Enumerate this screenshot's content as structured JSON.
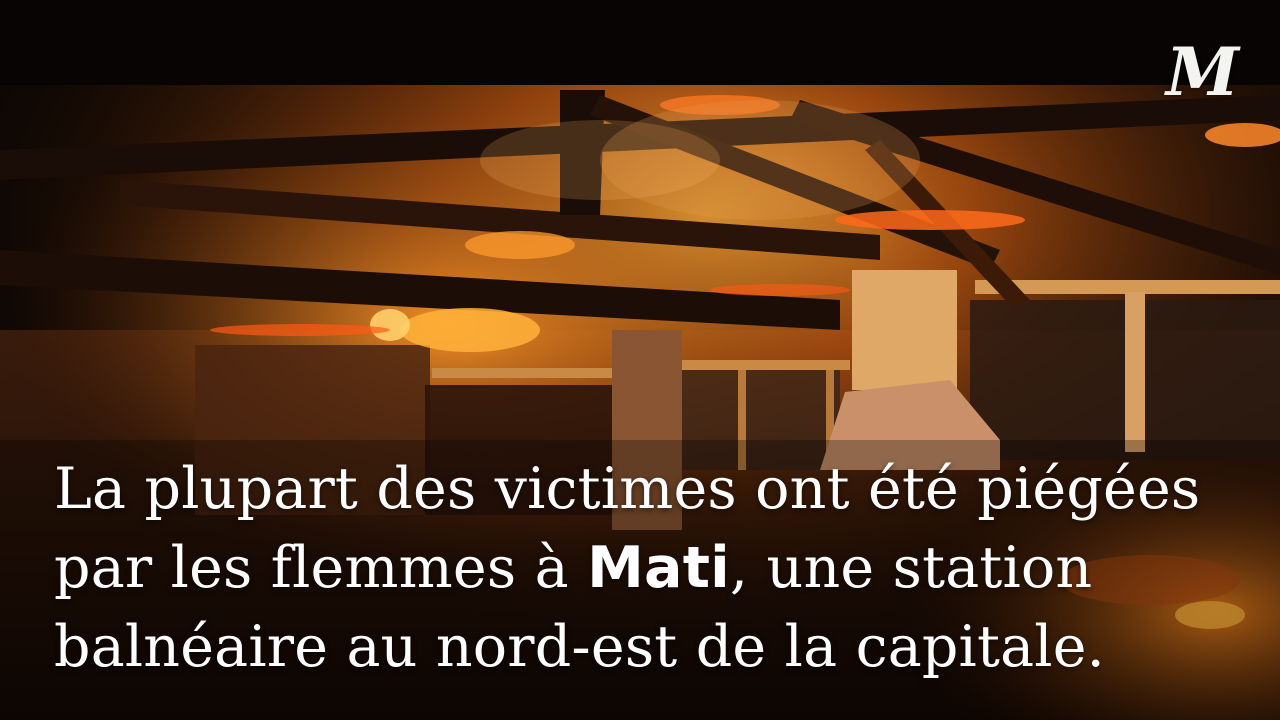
{
  "video": {
    "logo_letter": "M",
    "caption": {
      "before_bold": "La plupart des victimes ont été piégées par les flemmes à ",
      "bold": "Mati",
      "after_bold": ", une station balnéaire au nord-est de la capitale."
    }
  },
  "colors": {
    "background": "#0b0604",
    "fire": "#ffb13a",
    "ember": "#ff6a1a",
    "caption_text": "#ffffff"
  },
  "icons": [
    "le-monde-logo-icon"
  ]
}
